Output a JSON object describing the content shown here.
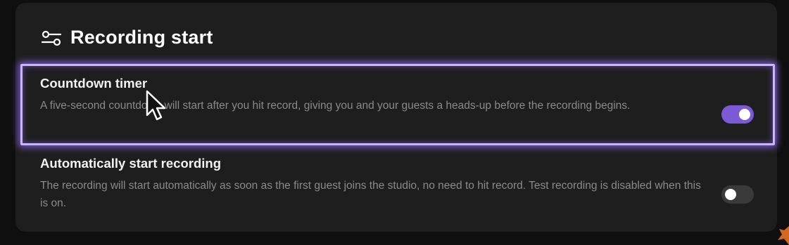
{
  "section": {
    "title": "Recording start",
    "icon": "settings-sliders-icon"
  },
  "settings": [
    {
      "title": "Countdown timer",
      "description": "A five-second countdown will start after you hit record, giving you and your guests a heads-up before the recording begins.",
      "enabled": true
    },
    {
      "title": "Automatically start recording",
      "description": "The recording will start automatically as soon as the first guest joins the studio, no need to hit record. Test recording is disabled when this is on.",
      "enabled": false
    }
  ],
  "colors": {
    "panel": "#1e1e1e",
    "accent": "#7c5ad6",
    "highlight": "#c9b6ff",
    "toggle_off": "#3a3a3a"
  }
}
